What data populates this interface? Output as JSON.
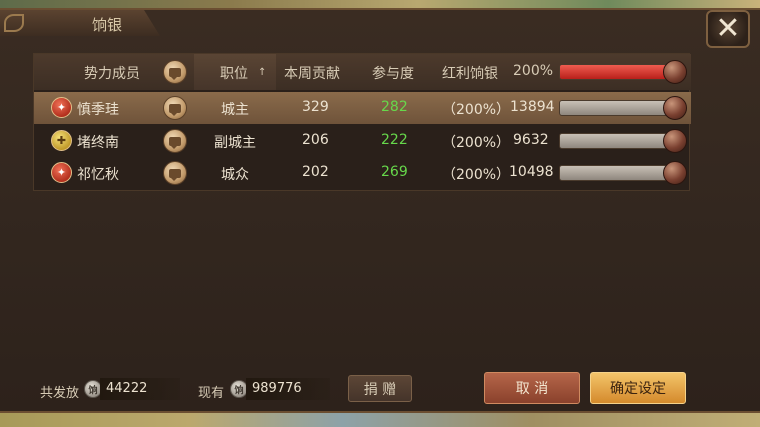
{
  "window": {
    "title": "饷银"
  },
  "table": {
    "headers": {
      "member": "势力成员",
      "position": "职位",
      "sort_arrow": "↑",
      "weekly_contribution": "本周贡献",
      "participation": "参与度",
      "bonus_silver": "红利饷银",
      "percent": "200%"
    },
    "rows": [
      {
        "name": "慎季珪",
        "position": "城主",
        "contribution": "329",
        "participation": "282",
        "bonus_pct": "（200%）",
        "silver": "13894",
        "slider_fraction": 1.0,
        "selected": true
      },
      {
        "name": "堵终南",
        "position": "副城主",
        "contribution": "206",
        "participation": "222",
        "bonus_pct": "（200%）",
        "silver": "9632",
        "slider_fraction": 1.0,
        "selected": false
      },
      {
        "name": "祁忆秋",
        "position": "城众",
        "contribution": "202",
        "participation": "269",
        "bonus_pct": "（200%）",
        "silver": "10498",
        "slider_fraction": 1.0,
        "selected": false
      }
    ],
    "header_slider_fraction": 1.0
  },
  "footer": {
    "total_label": "共发放",
    "total_value": "44222",
    "current_label": "现有",
    "current_value": "989776",
    "coin_glyph": "饷",
    "donate_label": "捐 赠",
    "cancel_label": "取 消",
    "confirm_label": "确定设定"
  },
  "icons": {
    "close": "close-icon",
    "chat": "chat-icon",
    "coin": "silver-coin-icon"
  },
  "colors": {
    "accent_green": "#67d84b",
    "slider_red": "#b8201a",
    "confirm_gold": "#f3c46a"
  }
}
